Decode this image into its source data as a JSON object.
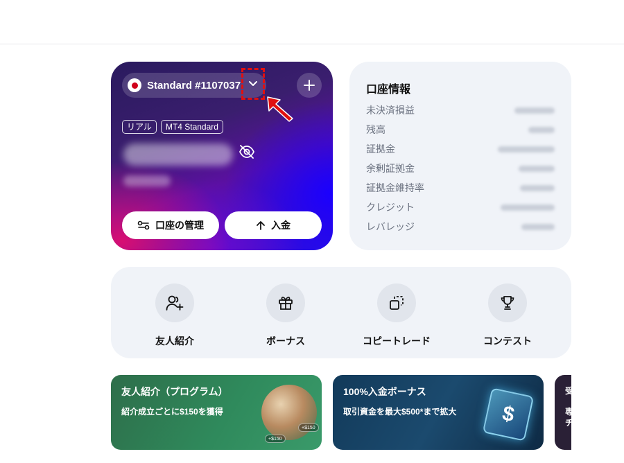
{
  "account_card": {
    "account_name": "Standard #1107037",
    "tags": [
      "リアル",
      "MT4 Standard"
    ],
    "manage_label": "口座の管理",
    "deposit_label": "入金"
  },
  "account_info": {
    "title": "口座情報",
    "rows": [
      {
        "label": "未決済損益"
      },
      {
        "label": "残高"
      },
      {
        "label": "証拠金"
      },
      {
        "label": "余剰証拠金"
      },
      {
        "label": "証拠金維持率"
      },
      {
        "label": "クレジット"
      },
      {
        "label": "レバレッジ"
      }
    ]
  },
  "actions": [
    {
      "label": "友人紹介",
      "icon": "user-plus-icon"
    },
    {
      "label": "ボーナス",
      "icon": "gift-icon"
    },
    {
      "label": "コピートレード",
      "icon": "copy-icon"
    },
    {
      "label": "コンテスト",
      "icon": "trophy-icon"
    }
  ],
  "banners": [
    {
      "title": "友人紹介（プログラム）",
      "subtitle": "紹介成立ごとに$150を獲得",
      "chips": [
        "+$150",
        "+$150"
      ]
    },
    {
      "title": "100%入金ボーナス",
      "subtitle": "取引資金を最大$500*まで拡大",
      "symbol": "$"
    },
    {
      "lines": [
        "受",
        "専",
        "チ"
      ]
    }
  ],
  "colors": {
    "highlight_box": "#e01010",
    "panel_bg": "#f0f3f8",
    "card_accent_pink": "#d80f72",
    "card_accent_blue": "#1a00ff"
  }
}
